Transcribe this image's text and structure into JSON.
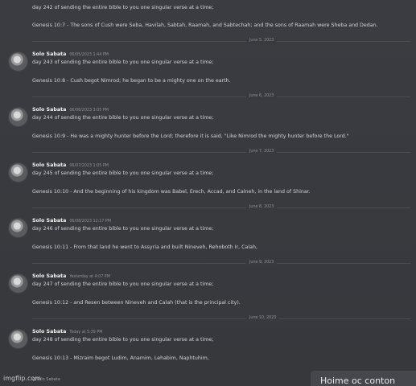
{
  "messages": [
    {
      "author": "",
      "timestamp": "",
      "line1": "day 242 of sending the entire bible to you one singular verse at a time;",
      "verse": "Genesis 10:7 - The sons of Cush were Seba, Havilah, Sabtah, Raamah, and Sabtechah; and the sons of Raamah were Sheba and Dedan."
    },
    {
      "author": "Solo Sabata",
      "timestamp": "06/05/2023 1:44 PM",
      "line1": "day 243 of sending the entire bible to you one singular verse at a time;",
      "verse": "Genesis 10:8 - Cush begot Nimrod; he began to be a mighty one on the earth."
    },
    {
      "author": "Solo Sabata",
      "timestamp": "06/06/2023 3:05 PM",
      "line1": "day 244 of sending the entire bible to you one singular verse at a time;",
      "verse": "Genesis 10:9 - He was a mighty hunter before the Lord; therefore it is said, \"Like Nimrod the mighty hunter before the Lord.\""
    },
    {
      "author": "Solo Sabata",
      "timestamp": "06/07/2023 1:05 PM",
      "line1": "day 245 of sending the entire bible to you one singular verse at a time;",
      "verse": "Genesis 10:10 - And the beginning of his kingdom was Babel, Erech, Accad, and Calneh, in the land of Shinar."
    },
    {
      "author": "Solo Sabata",
      "timestamp": "06/08/2023 12:17 PM",
      "line1": "day 246 of sending the entire bible to you one singular verse at a time;",
      "verse": "Genesis 10:11 - From that land he went to Assyria and built Nineveh, Rehoboth Ir, Calah,"
    },
    {
      "author": "Solo Sabata",
      "timestamp": "Yesterday at 4:07 PM",
      "line1": "day 247 of sending the entire bible to you one singular verse at a time;",
      "verse": "Genesis 10:12 - and Resen between Nineveh and Calah (that is the principal city)."
    },
    {
      "author": "Solo Sabata",
      "timestamp": "Today at 5:39 PM",
      "line1": "day 248 of sending the entire bible to you one singular verse at a time;",
      "verse": "Genesis 10:13 - Mizraim begot Ludim, Anamim, Lehabim, Naphtuhim,"
    }
  ],
  "dividers": [
    "June 5, 2023",
    "June 6, 2023",
    "June 7, 2023",
    "June 8, 2023",
    "June 9, 2023",
    "June 10, 2023"
  ],
  "footer": {
    "watermark": "imgflip.com",
    "reply_hint": "@Solo Sabata",
    "partial_text": "Hoime oc conton"
  }
}
